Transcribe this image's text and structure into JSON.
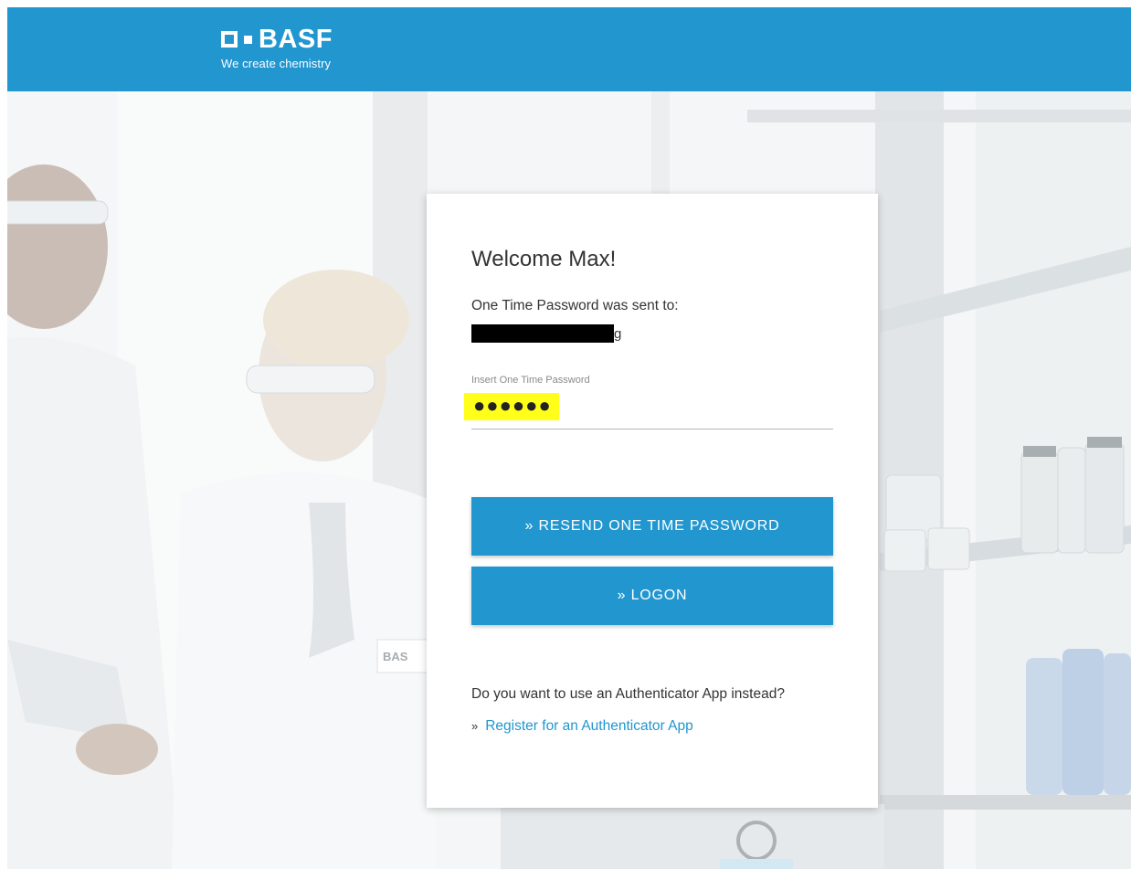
{
  "header": {
    "brand_name": "BASF",
    "tagline": "We create chemistry",
    "color": "#2196cf"
  },
  "background": {
    "description_icon": "lab-photo",
    "badge_text": "BAS"
  },
  "card": {
    "welcome": "Welcome Max!",
    "sent_to_label": "One Time Password was sent to:",
    "email_visible_tail": "g",
    "otp_label": "Insert One Time Password",
    "otp_value": "●●●●●●",
    "resend_button": "» RESEND ONE TIME PASSWORD",
    "logon_button": "» LOGON",
    "authenticator_question": "Do you want to use an Authenticator App instead?",
    "register_prefix": "»",
    "register_link": "Register for an Authenticator App"
  },
  "colors": {
    "accent": "#2196cf",
    "highlight": "#ffff1a"
  }
}
